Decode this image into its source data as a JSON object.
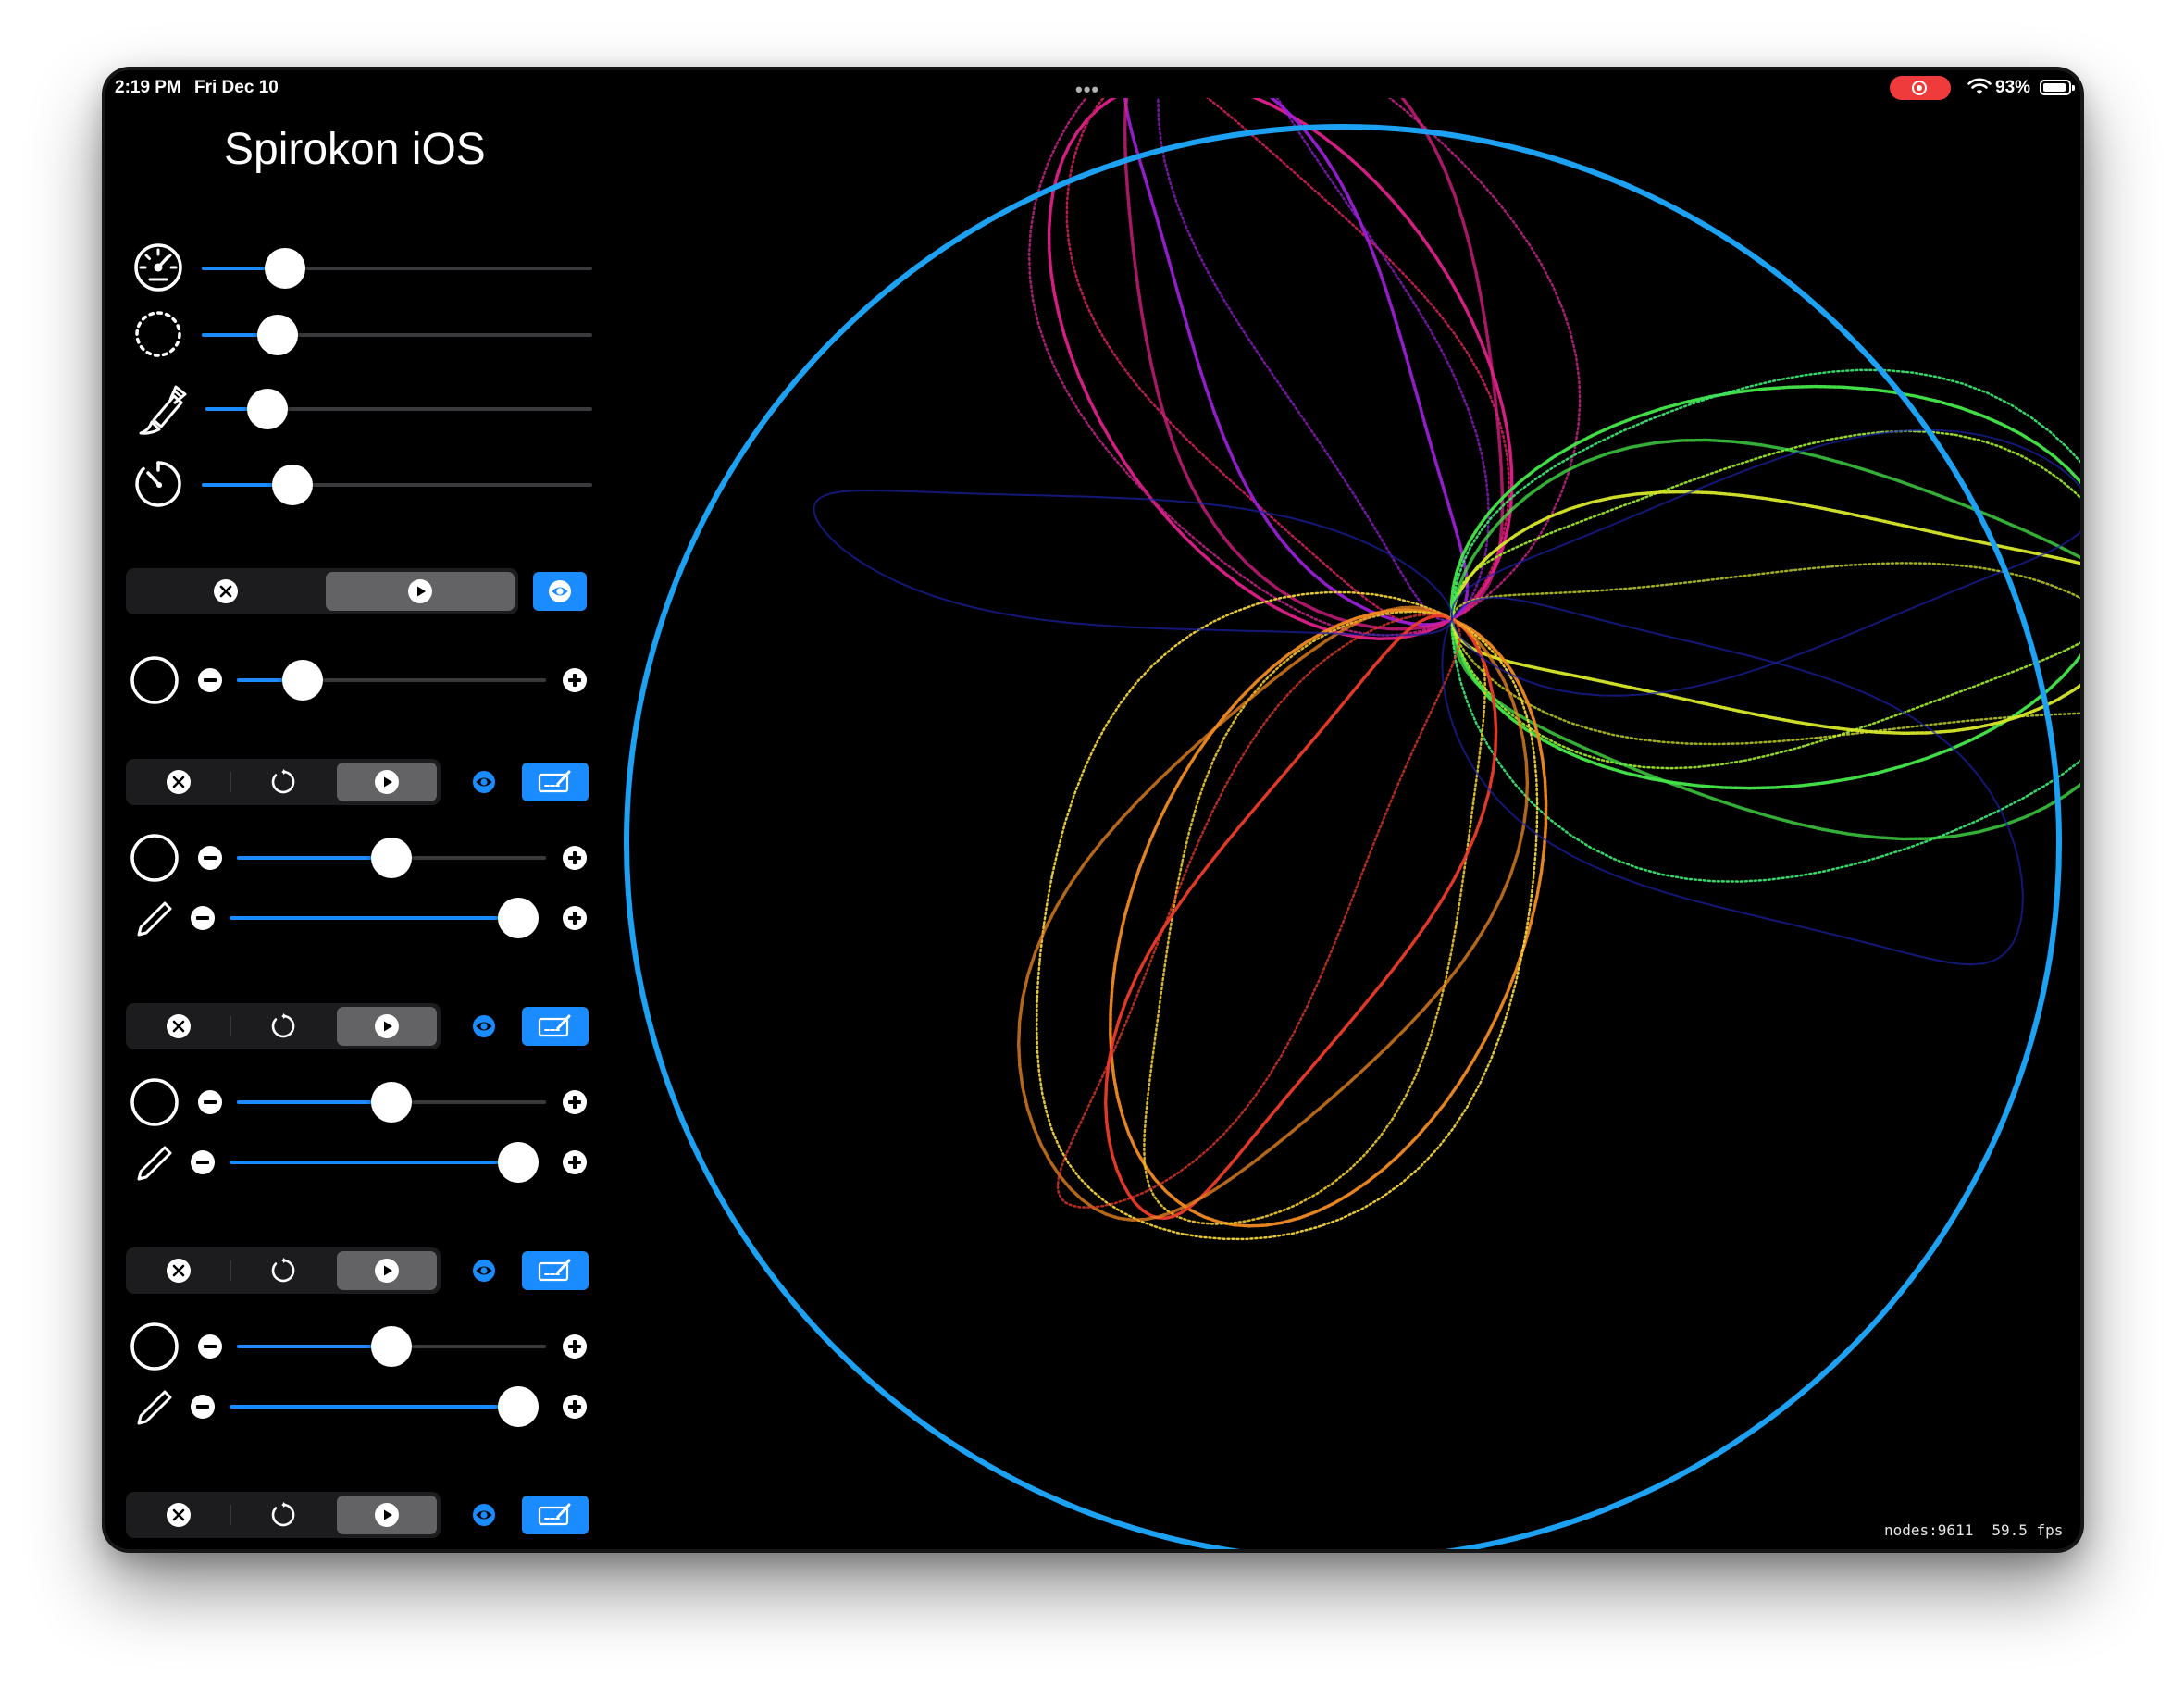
{
  "status_bar": {
    "time": "2:19 PM",
    "date": "Fri Dec 10",
    "multitask_indicator": "•••",
    "battery_percent": "93%",
    "recording_indicator": "screen-recording",
    "record_color": "#ef3b3b"
  },
  "app": {
    "title": "Spirokon iOS"
  },
  "colors": {
    "accent": "#1a8cff",
    "outer_ring": "#1da1f2",
    "background": "#000000",
    "segment_bg": "#1c1c1e",
    "segment_selected": "#636366"
  },
  "global_controls": {
    "speed": 0.18,
    "point_size": 0.16,
    "brush": 0.12,
    "timer": 0.2
  },
  "ring_0": {
    "mode": "play",
    "visible": true,
    "radius": 0.17
  },
  "rings": [
    {
      "mode": "play",
      "visible": true,
      "drawing": true,
      "radius": 0.5,
      "pen": 1.0
    },
    {
      "mode": "play",
      "visible": true,
      "drawing": true,
      "radius": 0.5,
      "pen": 1.0
    },
    {
      "mode": "play",
      "visible": true,
      "drawing": true,
      "radius": 0.5,
      "pen": 1.0
    },
    {
      "mode": "play",
      "visible": true,
      "drawing": true
    }
  ],
  "stats": {
    "nodes": "nodes:9611",
    "fps": "59.5 fps"
  }
}
